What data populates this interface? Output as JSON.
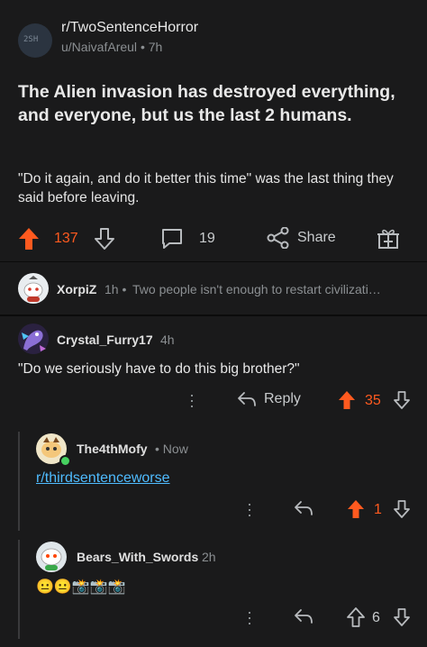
{
  "post": {
    "subreddit": "r/TwoSentenceHorror",
    "subreddit_avatar_text": "2SH",
    "author": "u/NaivafAreul",
    "age": "7h",
    "title": "The Alien invasion has destroyed everything, and everyone, but us the last 2 humans.",
    "body": "\"Do it again, and do it better this time\" was the last thing they said before leaving.",
    "upvotes": "137",
    "comments": "19",
    "share_label": "Share"
  },
  "comments": [
    {
      "user": "XorpiZ",
      "age": "1h",
      "collapsed_preview": "Two people isn't enough to restart civilizati…"
    },
    {
      "user": "Crystal_Furry17",
      "age": "4h",
      "text": "\"Do we seriously have to do this big brother?\"",
      "reply_label": "Reply",
      "score": "35"
    },
    {
      "user": "The4thMofy",
      "age": "Now",
      "link_text": "r/thirdsentenceworse",
      "score": "1"
    },
    {
      "user": "Bears_With_Swords",
      "age": "2h",
      "text": "😐😐📸📸📸",
      "score": "6"
    }
  ],
  "colors": {
    "upvote_active": "#ff5a1f",
    "link": "#4fbcff",
    "background": "#1a1a1b"
  }
}
